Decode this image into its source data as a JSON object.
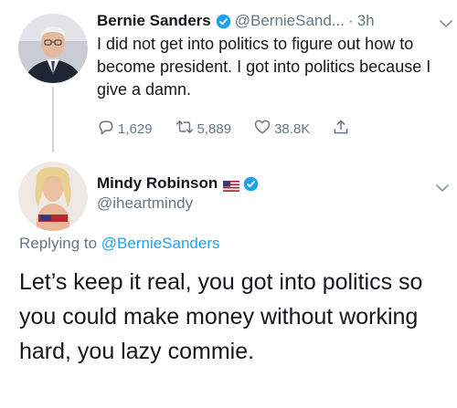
{
  "tweet": {
    "author_name": "Bernie Sanders",
    "author_handle": "@BernieSand...",
    "separator": "·",
    "time": "3h",
    "text": "I did not get into politics to figure out how to become president. I got into politics because I give a damn.",
    "replies_count": "1,629",
    "retweets_count": "5,889",
    "likes_count": "38.8K"
  },
  "reply": {
    "author_name": "Mindy Robinson",
    "author_handle": "@iheartmindy",
    "replying_label": "Replying to ",
    "replying_to": "@BernieSanders",
    "text": "Let’s keep it real, you got into politics so you could make money without working hard, you lazy commie."
  },
  "colors": {
    "verified_blue": "#1da1f2",
    "muted_gray": "#657786",
    "thread_line": "#ccd6dd"
  }
}
